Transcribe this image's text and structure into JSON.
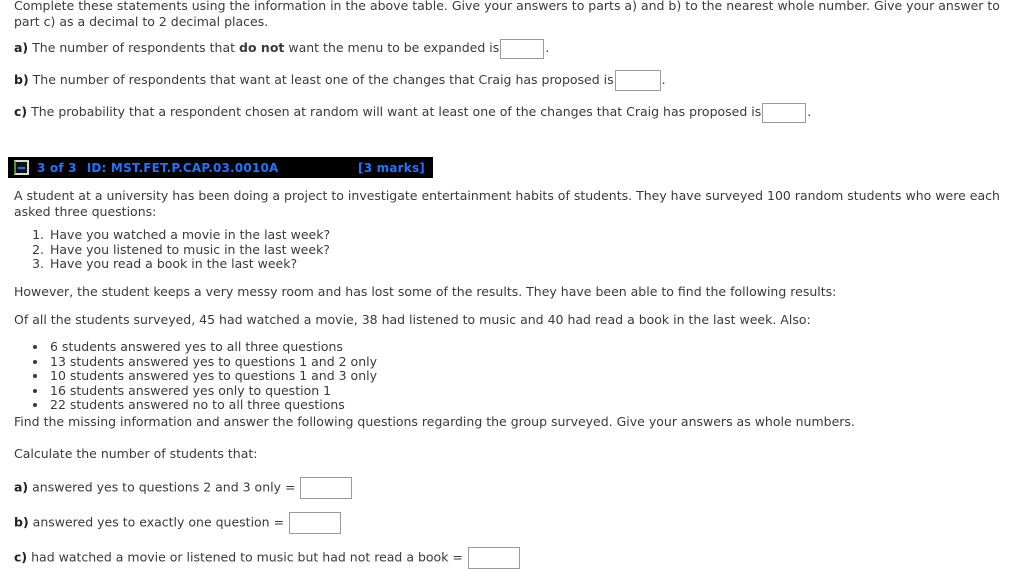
{
  "page": {
    "background": "#ffffff",
    "text_color": "#3a3a3a"
  },
  "previous_question": {
    "intro": "Complete these statements using the information in the above table. Give your answers to parts a) and b) to the nearest whole number. Give your answer to part c) as a decimal to 2 decimal places.",
    "parts": [
      {
        "label": "a)",
        "text_before": "The number of respondents that",
        "bold_text": "do not",
        "text_after": "want the menu to be expanded is",
        "input_value": "",
        "trailing": "."
      },
      {
        "label": "b)",
        "text_before": "The number of respondents that want at least one of the changes that Craig has proposed is",
        "bold_text": "",
        "text_after": "",
        "input_value": "",
        "trailing": "."
      },
      {
        "label": "c)",
        "text_before": "The probability that a respondent chosen at random will want at least one of the changes that Craig has proposed is",
        "bold_text": "",
        "text_after": "",
        "input_value": "",
        "trailing": "."
      }
    ]
  },
  "question_header": {
    "collapse_icon": "minus-icon",
    "number": "3 of 3",
    "id": "ID: MST.FET.P.CAP.03.0010A",
    "marks": "[3 marks]",
    "bar_background": "#000000",
    "text_color": "#1e74ff",
    "toggle_border_color": "#d8d8d8",
    "toggle_accent_color": "#5e8b2a"
  },
  "question": {
    "intro": "A student at a university has been doing a project to investigate entertainment habits of students. They have surveyed 100 random students who were each asked three questions:",
    "survey_questions": [
      "Have you watched a movie in the last week?",
      "Have you listened to music in the last week?",
      "Have you read a book in the last week?"
    ],
    "context_1": "However, the student keeps a very messy room and has lost some of the results. They have been able to find the following results:",
    "context_2": "Of all the students surveyed, 45 had watched a movie, 38 had listened to music and 40 had read a book in the last week. Also:",
    "findings": [
      "6 students answered yes to all three questions",
      "13 students answered yes to questions 1 and 2 only",
      "10 students answered yes to questions 1 and 3 only",
      "16 students answered yes only to question 1",
      "22 students answered no to all three questions"
    ],
    "instruction": "Find the missing information and answer the following questions regarding the group surveyed. Give your answers as whole numbers.",
    "prompt": "Calculate the number of students that:",
    "answer_parts": [
      {
        "label": "a)",
        "text": "answered yes to questions 2 and 3 only =",
        "input_value": ""
      },
      {
        "label": "b)",
        "text": "answered yes to exactly one question =",
        "input_value": ""
      },
      {
        "label": "c)",
        "text": "had watched a movie or listened to music but had not read a book =",
        "input_value": ""
      }
    ]
  }
}
